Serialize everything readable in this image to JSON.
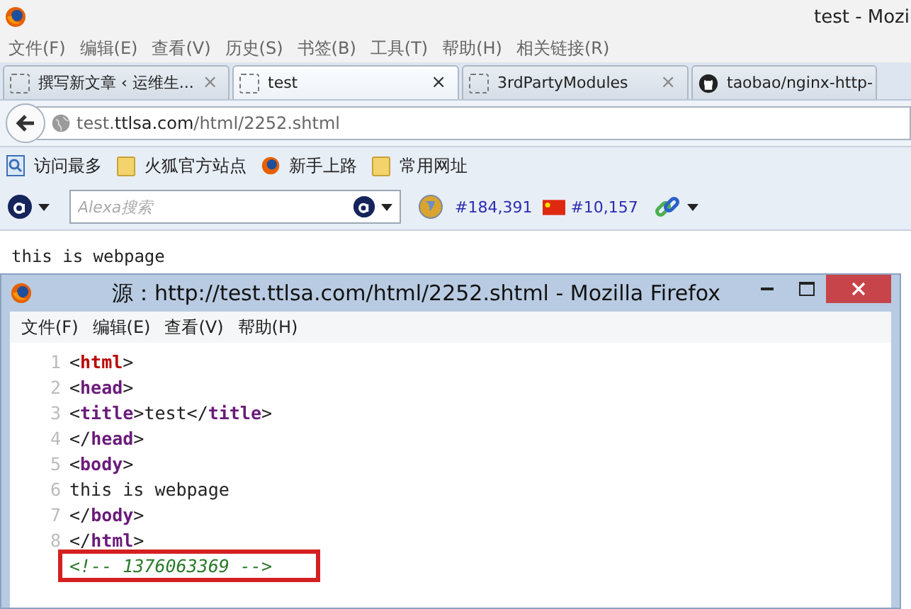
{
  "window": {
    "title": "test - Mozi"
  },
  "menu": [
    "文件(F)",
    "编辑(E)",
    "查看(V)",
    "历史(S)",
    "书签(B)",
    "工具(T)",
    "帮助(H)",
    "相关链接(R)"
  ],
  "tabs": [
    {
      "label": "撰写新文章 ‹ 运维生...",
      "selected": false,
      "close": "×"
    },
    {
      "label": "test",
      "selected": true,
      "close": "×"
    },
    {
      "label": "3rdPartyModules",
      "selected": false,
      "close": "×"
    },
    {
      "label": "taobao/nginx-http-",
      "selected": false
    }
  ],
  "address": {
    "host_pre": "test.",
    "host": "ttlsa.com",
    "path": "/html/2252.shtml"
  },
  "bookmarks": [
    {
      "label": "访问最多"
    },
    {
      "label": "火狐官方站点"
    },
    {
      "label": "新手上路"
    },
    {
      "label": "常用网址"
    }
  ],
  "alexa": {
    "placeholder": "Alexa搜索",
    "global_rank": "#184,391",
    "country_rank": "#10,157"
  },
  "page_text": "this is webpage",
  "source_window": {
    "title": "源：http://test.ttlsa.com/html/2252.shtml - Mozilla Firefox",
    "menu": [
      "文件(F)",
      "编辑(E)",
      "查看(V)",
      "帮助(H)"
    ],
    "lines": [
      {
        "number": "1",
        "highlighted": false,
        "tokens": [
          {
            "kind": "text",
            "text": "<"
          },
          {
            "kind": "root",
            "text": "html"
          },
          {
            "kind": "text",
            "text": ">"
          }
        ]
      },
      {
        "number": "2",
        "highlighted": false,
        "tokens": [
          {
            "kind": "text",
            "text": "<"
          },
          {
            "kind": "tag",
            "text": "head"
          },
          {
            "kind": "text",
            "text": ">"
          }
        ]
      },
      {
        "number": "3",
        "highlighted": false,
        "tokens": [
          {
            "kind": "text",
            "text": "<"
          },
          {
            "kind": "tag",
            "text": "title"
          },
          {
            "kind": "text",
            "text": ">test</"
          },
          {
            "kind": "tag",
            "text": "title"
          },
          {
            "kind": "text",
            "text": ">"
          }
        ]
      },
      {
        "number": "4",
        "highlighted": false,
        "tokens": [
          {
            "kind": "text",
            "text": "</"
          },
          {
            "kind": "tag",
            "text": "head"
          },
          {
            "kind": "text",
            "text": ">"
          }
        ]
      },
      {
        "number": "5",
        "highlighted": false,
        "tokens": [
          {
            "kind": "text",
            "text": "<"
          },
          {
            "kind": "tag",
            "text": "body"
          },
          {
            "kind": "text",
            "text": ">"
          }
        ]
      },
      {
        "number": "6",
        "highlighted": false,
        "tokens": [
          {
            "kind": "text",
            "text": "this is webpage"
          }
        ]
      },
      {
        "number": "7",
        "highlighted": false,
        "tokens": [
          {
            "kind": "text",
            "text": "</"
          },
          {
            "kind": "tag",
            "text": "body"
          },
          {
            "kind": "text",
            "text": ">"
          }
        ]
      },
      {
        "number": "8",
        "highlighted": false,
        "tokens": [
          {
            "kind": "text",
            "text": "</"
          },
          {
            "kind": "tag",
            "text": "html"
          },
          {
            "kind": "text",
            "text": ">"
          }
        ]
      },
      {
        "highlighted": true,
        "tokens": [
          {
            "kind": "comment",
            "text": "<!-- 1376063369 -->"
          }
        ]
      }
    ]
  }
}
